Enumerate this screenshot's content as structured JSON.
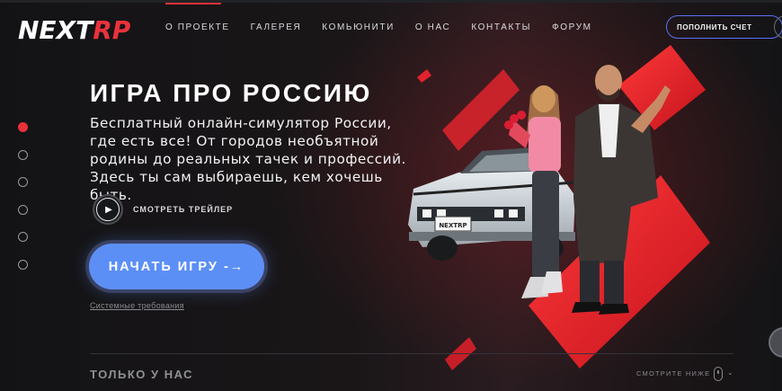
{
  "logo": {
    "part1": "NEXT",
    "part2": "RP"
  },
  "nav": [
    {
      "label": "О ПРОЕКТЕ",
      "active": true
    },
    {
      "label": "ГАЛЕРЕЯ",
      "active": false
    },
    {
      "label": "КОМЬЮНИТИ",
      "active": false
    },
    {
      "label": "О НАС",
      "active": false
    },
    {
      "label": "КОНТАКТЫ",
      "active": false
    },
    {
      "label": "ФОРУМ",
      "active": false
    }
  ],
  "header": {
    "topup_label": "ПОПОЛНИТЬ СЧЕТ",
    "user_icon": "user-icon"
  },
  "slides": {
    "count": 6,
    "active_index": 0
  },
  "hero": {
    "title": "ИГРА ПРО РОССИЮ",
    "description": "Бесплатный онлайн-симулятор России, где есть все! От городов необъятной родины до реальных тачек и профессий. Здесь ты сам выбираешь, кем хочешь быть.",
    "trailer_label": "СМОТРЕТЬ ТРЕЙЛЕР",
    "play_button": "НАЧАТЬ ИГРУ",
    "play_arrow": "-→",
    "system_requirements": "Системные требования",
    "plate_text": "NEXTRP"
  },
  "footer": {
    "section_title": "ТОЛЬКО У НАС",
    "scroll_hint": "СМОТРИТЕ НИЖЕ"
  },
  "colors": {
    "accent": "#e8313b",
    "button": "#5c8ff6",
    "background": "#141416"
  }
}
